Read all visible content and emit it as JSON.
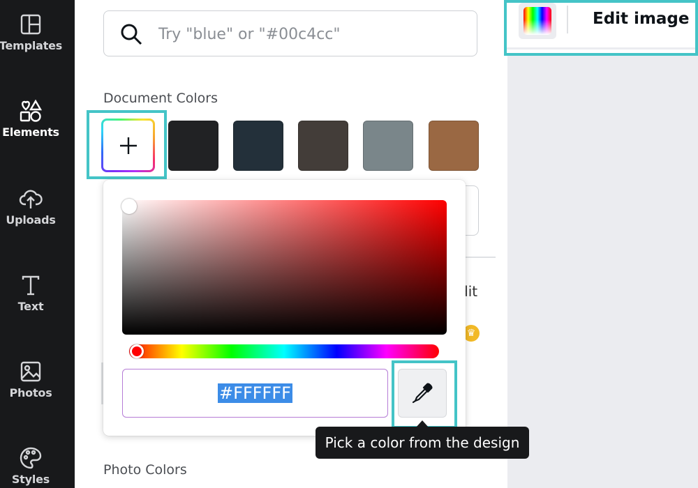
{
  "sidebar": {
    "items": [
      {
        "label": "Templates",
        "icon": "templates-icon"
      },
      {
        "label": "Elements",
        "icon": "elements-icon"
      },
      {
        "label": "Uploads",
        "icon": "upload-cloud-icon"
      },
      {
        "label": "Text",
        "icon": "text-icon"
      },
      {
        "label": "Photos",
        "icon": "photo-icon"
      },
      {
        "label": "Styles",
        "icon": "palette-icon"
      }
    ],
    "active": "Elements"
  },
  "search": {
    "placeholder": "Try \"blue\" or \"#00c4cc\""
  },
  "document_colors": {
    "title": "Document Colors",
    "swatches": [
      "#212224",
      "#23303a",
      "#433d39",
      "#7a868a",
      "#9a6843"
    ]
  },
  "photo_colors": {
    "title": "Photo Colors"
  },
  "color_picker": {
    "hex_value": "#FFFFFF",
    "eyedropper_tooltip": "Pick a color from the design"
  },
  "peek": {
    "text": "dit"
  },
  "header": {
    "edit_image_label": "Edit image"
  },
  "colors": {
    "highlight": "#44c4c7",
    "rail_bg": "#18191b",
    "selection": "#3c8ce7"
  }
}
